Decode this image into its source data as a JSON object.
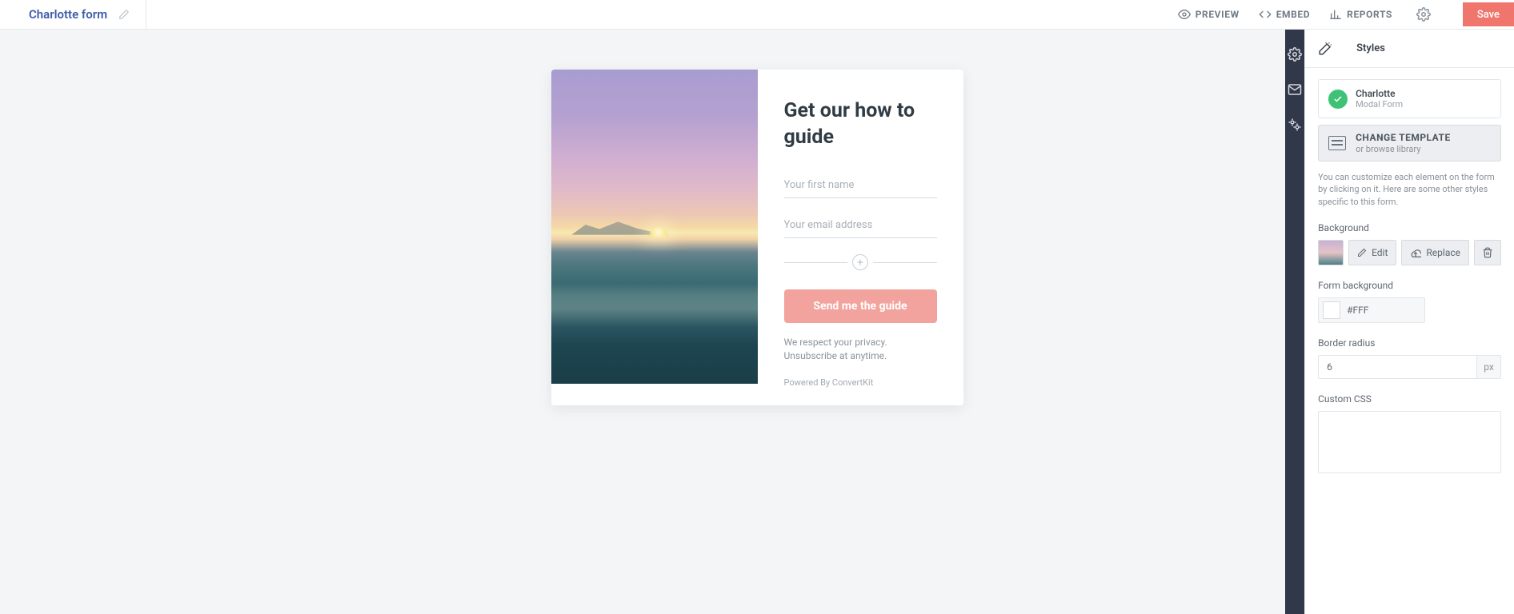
{
  "header": {
    "form_title": "Charlotte form",
    "preview": "PREVIEW",
    "embed": "EMBED",
    "reports": "REPORTS",
    "save": "Save"
  },
  "form": {
    "heading": "Get our how to guide",
    "first_name_placeholder": "Your first name",
    "email_placeholder": "Your email address",
    "submit": "Send me the guide",
    "privacy": "We respect your privacy. Unsubscribe at anytime.",
    "powered": "Powered By ConvertKit"
  },
  "panel": {
    "title": "Styles",
    "template_name": "Charlotte",
    "template_type": "Modal Form",
    "change_template": "CHANGE TEMPLATE",
    "change_sub": "or browse library",
    "help": "You can customize each element on the form by clicking on it. Here are some other styles specific to this form.",
    "background_label": "Background",
    "edit": "Edit",
    "replace": "Replace",
    "form_bg_label": "Form background",
    "form_bg_value": "#FFF",
    "radius_label": "Border radius",
    "radius_value": "6",
    "radius_unit": "px",
    "css_label": "Custom CSS"
  }
}
